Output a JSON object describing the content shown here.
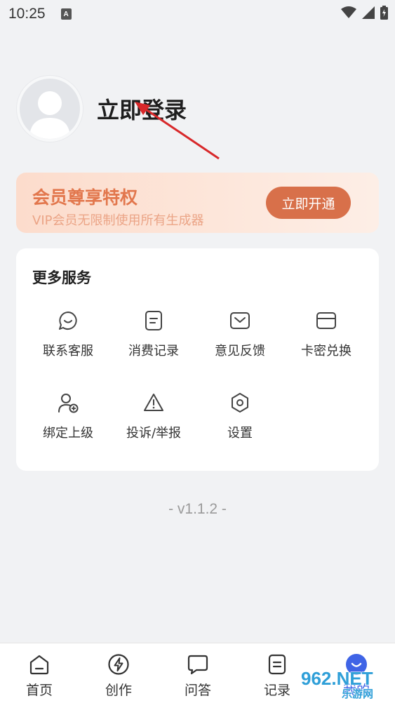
{
  "status_bar": {
    "time": "10:25",
    "badge": "A"
  },
  "profile": {
    "login_label": "立即登录"
  },
  "vip": {
    "title": "会员尊享特权",
    "subtitle": "VIP会员无限制使用所有生成器",
    "button": "立即开通"
  },
  "services": {
    "title": "更多服务",
    "items": [
      {
        "label": "联系客服",
        "icon": "chat-smile-icon"
      },
      {
        "label": "消费记录",
        "icon": "document-icon"
      },
      {
        "label": "意见反馈",
        "icon": "mail-icon"
      },
      {
        "label": "卡密兑换",
        "icon": "card-icon"
      },
      {
        "label": "绑定上级",
        "icon": "user-add-icon"
      },
      {
        "label": "投诉/举报",
        "icon": "warning-icon"
      },
      {
        "label": "设置",
        "icon": "settings-icon"
      }
    ]
  },
  "version": "- v1.1.2 -",
  "bottom_nav": {
    "items": [
      {
        "label": "首页",
        "icon": "home-icon"
      },
      {
        "label": "创作",
        "icon": "lightning-icon"
      },
      {
        "label": "问答",
        "icon": "chat-bubble-icon"
      },
      {
        "label": "记录",
        "icon": "record-icon"
      },
      {
        "label": "我的",
        "icon": "profile-icon"
      }
    ]
  },
  "watermark": {
    "text": "962.NET",
    "subtext": "乐游网"
  },
  "colors": {
    "accent": "#d8704a",
    "vip_title": "#e2774d",
    "active_tab": "#3f64e6"
  }
}
